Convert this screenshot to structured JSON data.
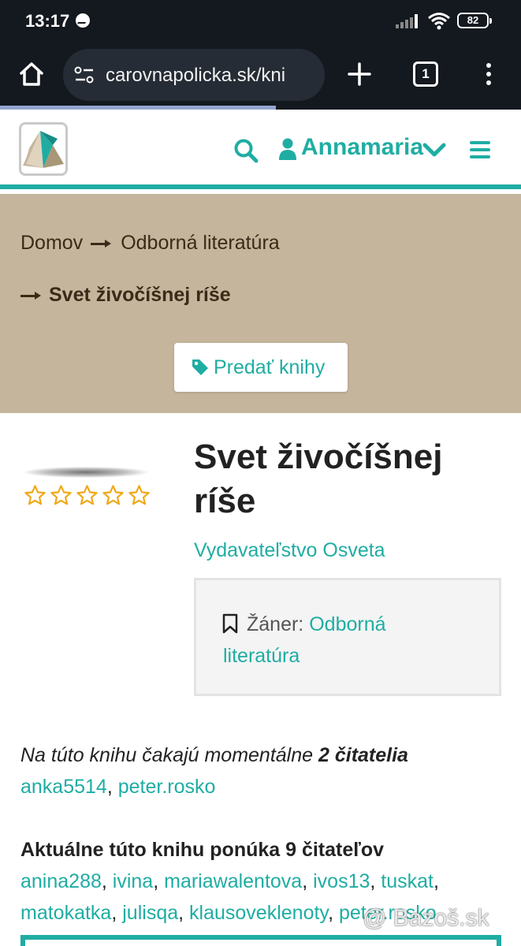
{
  "status_bar": {
    "time": "13:17",
    "battery": "82"
  },
  "browser": {
    "url": "carovnapolicka.sk/kni",
    "tab_count": "1",
    "load_progress": 0.53
  },
  "header": {
    "user_name": "Annamaria"
  },
  "breadcrumb": {
    "home": "Domov",
    "category": "Odborná literatúra",
    "current": "Svet živočíšnej ríše"
  },
  "sell_button": {
    "label": "Predať knihy"
  },
  "book": {
    "title": "Svet živočíšnej ríše",
    "rating": 0,
    "rating_max": 5,
    "publisher": "Vydavateľstvo Osveta",
    "genre_label": "Žáner:",
    "genre_line1": "Odborná",
    "genre_line2": "literatúra"
  },
  "waiting": {
    "text": "Na túto knihu čakajú momentálne",
    "count_text": "2 čitatelia",
    "users": [
      "anka5514",
      "peter.rosko"
    ]
  },
  "offers": {
    "heading": "Aktuálne túto knihu ponúka 9 čitateľov",
    "users": [
      "anina288",
      "ivina",
      "mariawalentova",
      "ivos13",
      "tuskat",
      "matokatka",
      "julisqa",
      "klausoveklenoty",
      "peter.rosko"
    ]
  },
  "watermark": "@ Bazoš.sk",
  "colors": {
    "accent": "#1fada3",
    "breadcrumb_bg": "#c4b59c",
    "star": "#f0a818",
    "browser_bg": "#14181f"
  }
}
